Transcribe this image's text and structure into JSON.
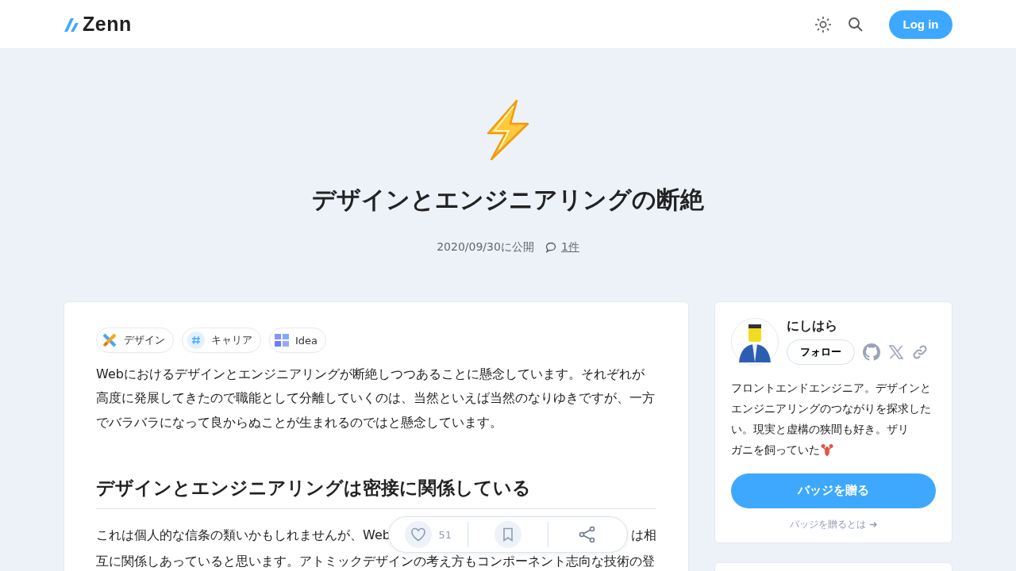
{
  "header": {
    "logo": "Zenn",
    "login": "Log in"
  },
  "article": {
    "title": "デザインとエンジニアリングの断絶",
    "published": "2020/09/30に公開",
    "comments": "1件",
    "tags": [
      {
        "label": "デザイン"
      },
      {
        "label": "キャリア"
      },
      {
        "label": "Idea"
      }
    ],
    "intro": "Webにおけるデザインとエンジニアリングが断絶しつつあることに懸念しています。それぞれが高度に発展してきたので職能として分離していくのは、当然といえば当然のなりゆきですが、一方でバラバラになって良からぬことが生まれるのではと懸念しています。",
    "heading": "デザインとエンジニアリングは密接に関係している",
    "para_line1_start": "これは個人的な信条の類いかもしれませんが、Web",
    "para_line1_end": "は相",
    "para_line2": "互に関係しあっていると思います。アトミックデザインの考え方もコンポーネント志向な技術の登"
  },
  "actions": {
    "likes": "51"
  },
  "author": {
    "name": "にしはら",
    "follow": "フォロー",
    "bio": "フロントエンドエンジニア。デザインとエンジニアリングのつながりを探求したい。現実と虚構の狭間も好き。ザリ",
    "bio_end": "ガニを飼っていた",
    "badge_button": "バッジを贈る",
    "badge_link": "バッジを贈るとは"
  }
}
